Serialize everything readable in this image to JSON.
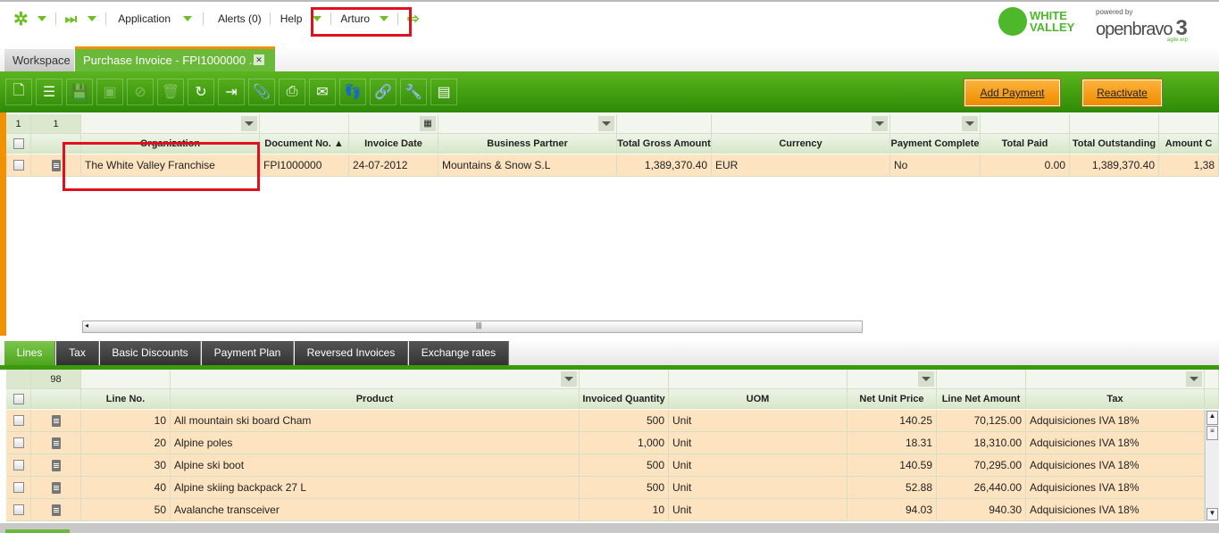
{
  "nav": {
    "application": "Application",
    "alerts": "Alerts (0)",
    "help": "Help",
    "user": "Arturo"
  },
  "logos": {
    "client": "WHITE VALLEY",
    "powered_by": "powered by",
    "brand": "openbravo",
    "version": "3",
    "tagline": "agile erp"
  },
  "tabs": [
    {
      "label": "Workspace"
    },
    {
      "label": "Purchase Invoice - FPI1000000 ..."
    }
  ],
  "toolbar": {
    "add_payment": "Add Payment",
    "reactivate": "Reactivate"
  },
  "header_grid": {
    "count": "1",
    "count2": "1",
    "columns": [
      "Organization",
      "Document No. ▲",
      "Invoice Date",
      "Business Partner",
      "Total Gross Amount",
      "Currency",
      "Payment Complete",
      "Total Paid",
      "Total Outstanding",
      "Amount C"
    ],
    "rows": [
      [
        "The White Valley Franchise",
        "FPI1000000",
        "24-07-2012",
        "Mountains & Snow S.L",
        "1,389,370.40",
        "EUR",
        "No",
        "0.00",
        "1,389,370.40",
        "1,38"
      ]
    ]
  },
  "subtabs": [
    "Lines",
    "Tax",
    "Basic Discounts",
    "Payment Plan",
    "Reversed Invoices",
    "Exchange rates"
  ],
  "lines_grid": {
    "count": "98",
    "columns": [
      "Line No.",
      "Product",
      "Invoiced Quantity",
      "UOM",
      "Net Unit Price",
      "Line Net Amount",
      "Tax"
    ],
    "rows": [
      [
        "10",
        "All mountain ski board Cham",
        "500",
        "Unit",
        "140.25",
        "70,125.00",
        "Adquisiciones IVA 18%"
      ],
      [
        "20",
        "Alpine poles",
        "1,000",
        "Unit",
        "18.31",
        "18,310.00",
        "Adquisiciones IVA 18%"
      ],
      [
        "30",
        "Alpine ski boot",
        "500",
        "Unit",
        "140.59",
        "70,295.00",
        "Adquisiciones IVA 18%"
      ],
      [
        "40",
        "Alpine skiing backpack 27 L",
        "500",
        "Unit",
        "52.88",
        "26,440.00",
        "Adquisiciones IVA 18%"
      ],
      [
        "50",
        "Avalanche transceiver",
        "10",
        "Unit",
        "94.03",
        "940.30",
        "Adquisiciones IVA 18%"
      ]
    ]
  }
}
